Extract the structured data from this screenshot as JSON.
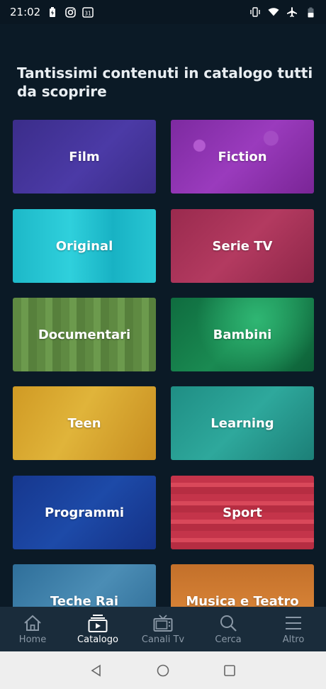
{
  "status_bar": {
    "time": "21:02",
    "calendar_day": "31",
    "icons_left": [
      "battery-charging-icon",
      "instagram-icon",
      "calendar-icon"
    ],
    "icons_right": [
      "vibrate-icon",
      "wifi-icon",
      "airplane-icon",
      "battery-icon"
    ]
  },
  "main": {
    "heading": "Tantissimi contenuti in catalogo tutti da scoprire",
    "tiles": [
      {
        "label": "Film"
      },
      {
        "label": "Fiction"
      },
      {
        "label": "Original"
      },
      {
        "label": "Serie TV"
      },
      {
        "label": "Documentari"
      },
      {
        "label": "Bambini"
      },
      {
        "label": "Teen"
      },
      {
        "label": "Learning"
      },
      {
        "label": "Programmi"
      },
      {
        "label": "Sport"
      },
      {
        "label": "Teche Rai"
      },
      {
        "label": "Musica e Teatro"
      }
    ]
  },
  "bottom_nav": {
    "items": [
      {
        "label": "Home",
        "icon": "home-icon",
        "active": false
      },
      {
        "label": "Catalogo",
        "icon": "catalog-icon",
        "active": true
      },
      {
        "label": "Canali Tv",
        "icon": "tv-icon",
        "active": false
      },
      {
        "label": "Cerca",
        "icon": "search-icon",
        "active": false
      },
      {
        "label": "Altro",
        "icon": "menu-icon",
        "active": false
      }
    ]
  },
  "colors": {
    "background": "#0b1a26",
    "nav_background": "#1a2c3b",
    "nav_inactive": "#8a98a6",
    "nav_active": "#ffffff"
  }
}
